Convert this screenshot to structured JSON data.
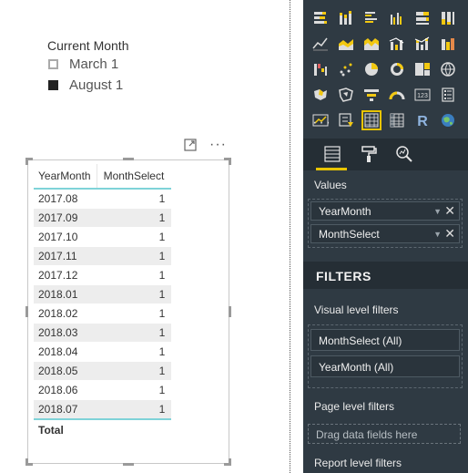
{
  "slicer": {
    "title": "Current Month",
    "items": [
      {
        "label": "March 1",
        "checked": false
      },
      {
        "label": "August 1",
        "checked": true
      }
    ]
  },
  "visual_header": {
    "focus_icon": "focus-mode-icon",
    "more_icon": "more-options-icon",
    "more_glyph": "···"
  },
  "table": {
    "headers": [
      "YearMonth",
      "MonthSelect"
    ],
    "rows": [
      [
        "2017.08",
        "1"
      ],
      [
        "2017.09",
        "1"
      ],
      [
        "2017.10",
        "1"
      ],
      [
        "2017.11",
        "1"
      ],
      [
        "2017.12",
        "1"
      ],
      [
        "2018.01",
        "1"
      ],
      [
        "2018.02",
        "1"
      ],
      [
        "2018.03",
        "1"
      ],
      [
        "2018.04",
        "1"
      ],
      [
        "2018.05",
        "1"
      ],
      [
        "2018.06",
        "1"
      ],
      [
        "2018.07",
        "1"
      ]
    ],
    "total_label": "Total"
  },
  "pane": {
    "viz_more": "···",
    "values_label": "Values",
    "fields": [
      {
        "label": "YearMonth"
      },
      {
        "label": "MonthSelect"
      }
    ],
    "filters_title": "FILTERS",
    "visual_level_label": "Visual level filters",
    "visual_filters": [
      {
        "label": "MonthSelect  (All)"
      },
      {
        "label": "YearMonth  (All)"
      }
    ],
    "page_level_label": "Page level filters",
    "drag_placeholder": "Drag data fields here",
    "report_level_label": "Report level filters",
    "remove_glyph": "✕",
    "chevron_glyph": "▼"
  },
  "colors": {
    "pane_bg": "#2f3a43",
    "accent": "#e8c400",
    "table_rule": "#7fd3d8"
  }
}
